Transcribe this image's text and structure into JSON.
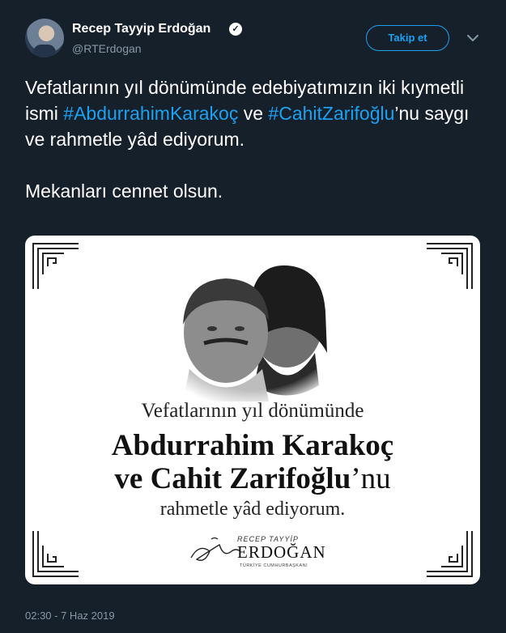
{
  "author": {
    "name": "Recep Tayyip Erdoğan",
    "handle": "@RTErdogan",
    "verified_icon": "verified-badge-icon"
  },
  "follow_button": {
    "label": "Takip et"
  },
  "menu_icon": "chevron-down-icon",
  "tweet": {
    "seg1": "Vefatlarının yıl dönümünde edebiyatımızın iki kıymetli ismi ",
    "hashtag1": "#AbdurrahimKarakoç",
    "seg2": " ve ",
    "hashtag2": "#CahitZarifoğlu",
    "seg3": "’nu saygı ve rahmetle yâd ediyorum.",
    "paragraph2": "Mekanları cennet olsun."
  },
  "media": {
    "line1": "Vefatlarının yıl dönümünde",
    "line2": "Abdurrahim Karakoç",
    "line3_bold": "ve Cahit Zarifoğlu",
    "line3_suffix": "’nu",
    "line4": "rahmetle yâd ediyorum.",
    "logo_small": "RECEP TAYYİP",
    "logo_big": "ERDOĞAN",
    "logo_sub": "TÜRKİYE CUMHURBAŞKANI"
  },
  "timestamp": "02:30 - 7 Haz 2019",
  "colors": {
    "background": "#15202b",
    "accent": "#1da1f2",
    "muted": "#8899a6"
  }
}
